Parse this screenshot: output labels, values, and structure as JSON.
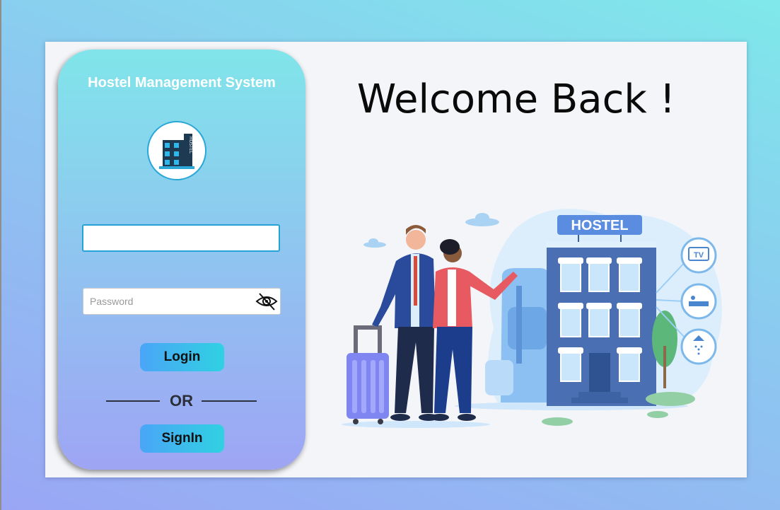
{
  "app": {
    "title": "Hostel Management System",
    "logo_text": "HOSTEL"
  },
  "login_form": {
    "username": {
      "value": "",
      "placeholder": ""
    },
    "password": {
      "value": "",
      "placeholder": "Password"
    },
    "login_label": "Login",
    "or_label": "OR",
    "signin_label": "SignIn"
  },
  "welcome": {
    "heading": "Welcome Back !",
    "illustration": {
      "sign_text": "HOSTEL",
      "amenity_tv": "TV"
    }
  },
  "colors": {
    "accent_start": "#4ba5f7",
    "accent_end": "#2fd1e2",
    "focus_border": "#27a2d6",
    "building": "#4a6fb3"
  }
}
